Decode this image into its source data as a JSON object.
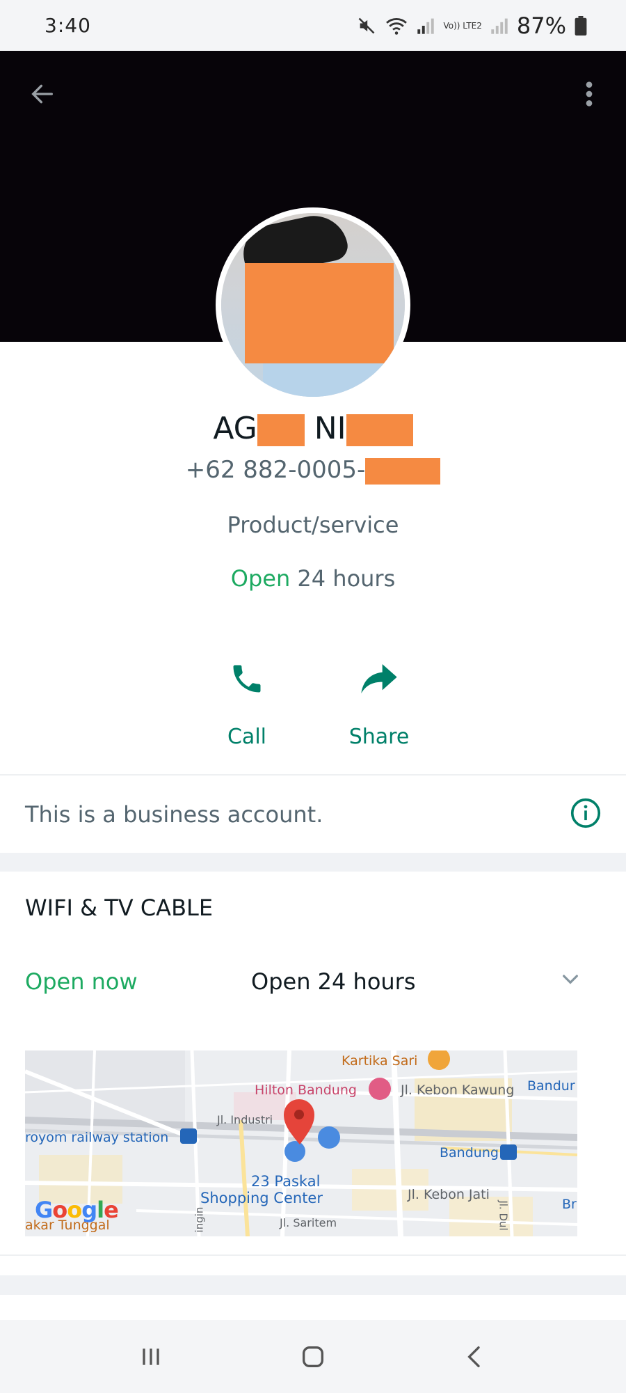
{
  "status_bar": {
    "time": "3:40",
    "network_label": "Vo)) LTE2",
    "battery": "87%"
  },
  "contact": {
    "name_prefix": "AG",
    "name_middle": "NI",
    "phone_prefix": "+62 882-0005-",
    "category": "Product/service",
    "open_label": "Open",
    "hours_label": "24 hours"
  },
  "actions": {
    "call_label": "Call",
    "share_label": "Share"
  },
  "business_notice": "This is a business account.",
  "business_section": {
    "title": "WIFI & TV CABLE",
    "open_now": "Open now",
    "hours": "Open 24 hours"
  },
  "map": {
    "labels": {
      "kartika": "Kartika Sari",
      "hilton": "Hilton Bandung",
      "kebon_kawung": "Jl. Kebon Kawung",
      "bandung_top": "Bandur",
      "industri": "Jl. Industri",
      "station": "royom railway station",
      "bandung_station": "Bandung",
      "paskal": "23 Paskal",
      "shopping": "Shopping Center",
      "kebon_jati": "Jl. Kebon Jati",
      "br": "Br",
      "saritem": "Jl. Saritem",
      "tunggal": "akar Tunggal",
      "ingin": "ingin",
      "dul": "Jl. Dul"
    },
    "google": "Google"
  },
  "colors": {
    "accent": "#008069",
    "open_green": "#1daa61",
    "redaction": "#f58a42"
  },
  "icons": {
    "back": "arrow-back-icon",
    "menu": "more-vert-icon",
    "call": "phone-icon",
    "share": "share-arrow-icon",
    "info": "info-icon",
    "expand": "chevron-down-icon"
  }
}
